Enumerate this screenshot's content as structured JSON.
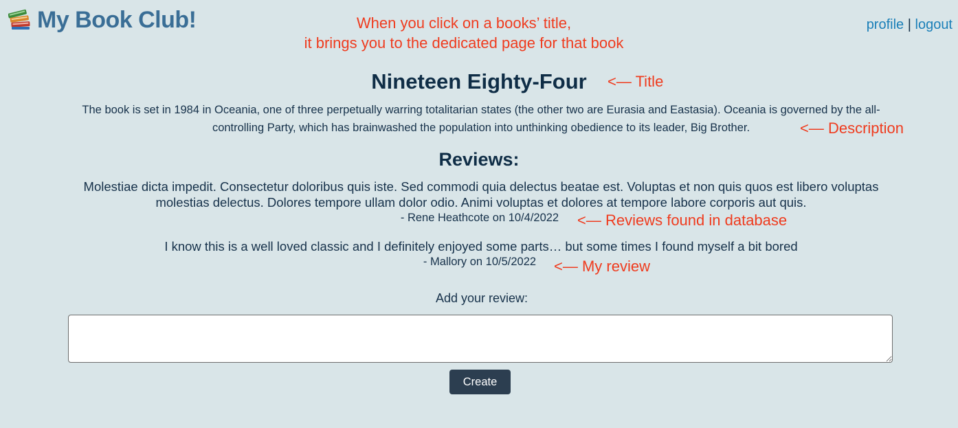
{
  "header": {
    "brand_title": "My Book Club!",
    "brand_icon": "books-icon",
    "nav": {
      "profile": "profile",
      "separator": "|",
      "logout": "logout"
    }
  },
  "annotations": {
    "click_note_line1": "When you click on a books’ title,",
    "click_note_line2": "it brings you to the dedicated page for that book",
    "title": "<— Title",
    "description": "<— Description",
    "reviews_db": "<— Reviews found in database",
    "my_review": "<— My review"
  },
  "book": {
    "title": "Nineteen Eighty-Four",
    "description": "The book is set in 1984 in Oceania, one of three perpetually warring totalitarian states (the other two are Eurasia and Eastasia). Oceania is governed by the all-controlling Party, which has brainwashed the population into unthinking obedience to its leader, Big Brother."
  },
  "reviews": {
    "heading": "Reviews:",
    "items": [
      {
        "text": "Molestiae dicta impedit. Consectetur doloribus quis iste. Sed commodi quia delectus beatae est. Voluptas et non quis quos est libero voluptas molestias delectus. Dolores tempore ullam dolor odio. Animi voluptas et dolores at tempore labore corporis aut quis.",
        "author": "- Rene Heathcote on 10/4/2022"
      },
      {
        "text": "I know this is a well loved classic and I definitely enjoyed some parts… but some times I found myself a bit bored",
        "author": "- Mallory on 10/5/2022"
      }
    ]
  },
  "form": {
    "label": "Add your review:",
    "input_value": "",
    "submit_label": "Create"
  },
  "colors": {
    "background": "#d9e5e8",
    "brand": "#3a6e96",
    "link": "#1a7fb8",
    "annotation": "#ef3b1e",
    "button": "#2c3e50"
  }
}
